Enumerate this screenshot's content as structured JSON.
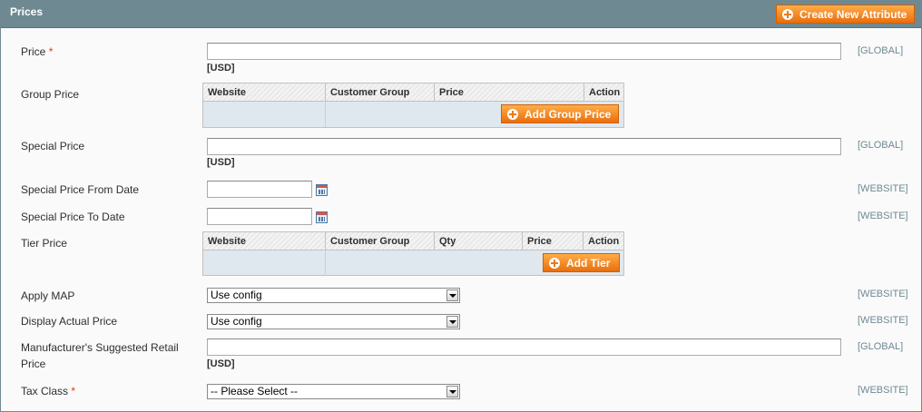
{
  "panel": {
    "title": "Prices",
    "create_attribute_button": "Create New Attribute"
  },
  "fields": {
    "price": {
      "label": "Price",
      "required_mark": "*",
      "value": "",
      "unit": "[USD]",
      "scope": "[GLOBAL]"
    },
    "group_price": {
      "label": "Group Price",
      "columns": [
        "Website",
        "Customer Group",
        "Price",
        "Action"
      ],
      "add_button": "Add Group Price"
    },
    "special_price": {
      "label": "Special Price",
      "value": "",
      "unit": "[USD]",
      "scope": "[GLOBAL]"
    },
    "special_from": {
      "label": "Special Price From Date",
      "value": "",
      "scope": "[WEBSITE]",
      "icon": "calendar-icon"
    },
    "special_to": {
      "label": "Special Price To Date",
      "value": "",
      "scope": "[WEBSITE]",
      "icon": "calendar-icon"
    },
    "tier_price": {
      "label": "Tier Price",
      "columns": [
        "Website",
        "Customer Group",
        "Qty",
        "Price",
        "Action"
      ],
      "add_button": "Add Tier"
    },
    "apply_map": {
      "label": "Apply MAP",
      "selected": "Use config",
      "scope": "[WEBSITE]"
    },
    "display_actual_price": {
      "label": "Display Actual Price",
      "selected": "Use config",
      "scope": "[WEBSITE]"
    },
    "msrp": {
      "label_line1": "Manufacturer's Suggested Retail",
      "label_line2": "Price",
      "value": "",
      "unit": "[USD]",
      "scope": "[GLOBAL]"
    },
    "tax_class": {
      "label": "Tax Class",
      "required_mark": "*",
      "selected": "-- Please Select --",
      "scope": "[WEBSITE]"
    }
  },
  "colors": {
    "header": "#6f8992",
    "button_orange": "#eb7a14",
    "required": "#eb340a",
    "grid_body": "#dfe8ee"
  }
}
